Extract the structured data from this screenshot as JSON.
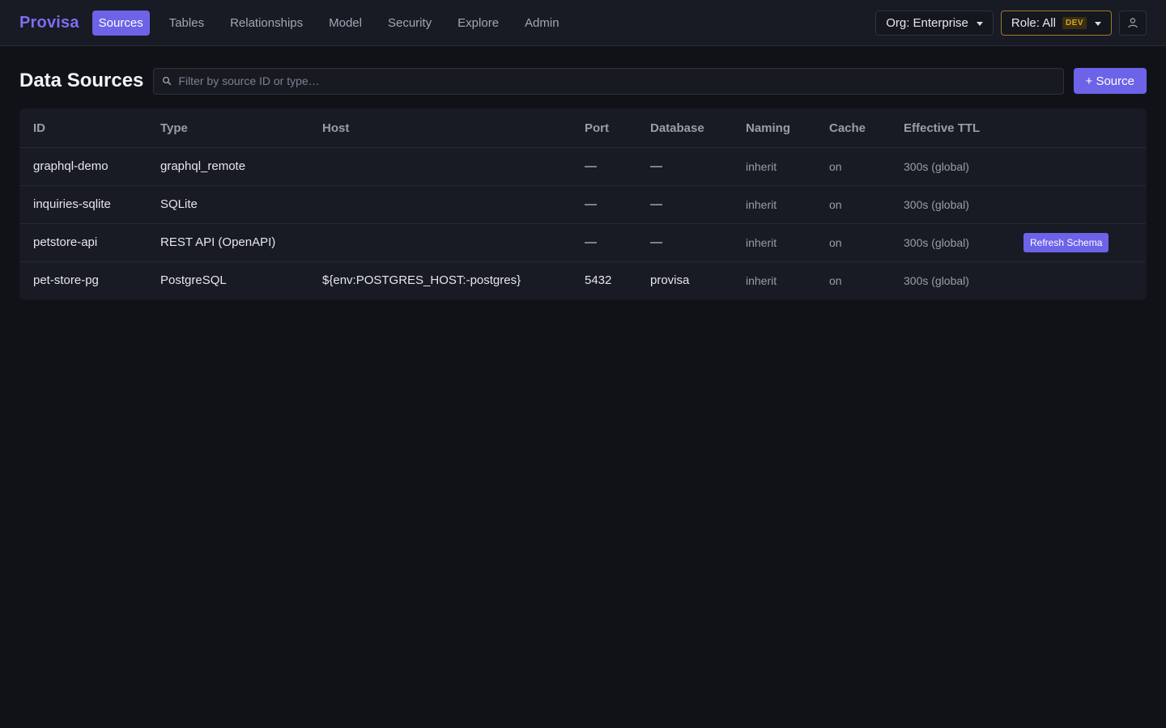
{
  "app": {
    "brand": "Provisa"
  },
  "nav": {
    "items": [
      {
        "label": "Sources",
        "active": true
      },
      {
        "label": "Tables"
      },
      {
        "label": "Relationships"
      },
      {
        "label": "Model"
      },
      {
        "label": "Security"
      },
      {
        "label": "Explore"
      },
      {
        "label": "Admin"
      }
    ]
  },
  "topbar": {
    "org_label": "Org: Enterprise",
    "role_label": "Role: All",
    "role_badge": "DEV",
    "icons": {
      "user": "user-icon",
      "caret": "chevron-down-icon"
    }
  },
  "page": {
    "title": "Data Sources",
    "search_placeholder": "Filter by source ID or type…",
    "add_label": "+ Source"
  },
  "table": {
    "columns": [
      "ID",
      "Type",
      "Host",
      "Port",
      "Database",
      "Naming",
      "Cache",
      "Effective TTL",
      ""
    ],
    "rows": [
      {
        "id": "graphql-demo",
        "type": "graphql_remote",
        "host": "",
        "port": "—",
        "database": "—",
        "naming": "inherit",
        "cache": "on",
        "ttl": "300s (global)",
        "action": ""
      },
      {
        "id": "inquiries-sqlite",
        "type": "SQLite",
        "host": "",
        "port": "—",
        "database": "—",
        "naming": "inherit",
        "cache": "on",
        "ttl": "300s (global)",
        "action": ""
      },
      {
        "id": "petstore-api",
        "type": "REST API (OpenAPI)",
        "host": "",
        "port": "—",
        "database": "—",
        "naming": "inherit",
        "cache": "on",
        "ttl": "300s (global)",
        "action": "Refresh Schema"
      },
      {
        "id": "pet-store-pg",
        "type": "PostgreSQL",
        "host": "${env:POSTGRES_HOST:-postgres}",
        "port": "5432",
        "database": "provisa",
        "naming": "inherit",
        "cache": "on",
        "ttl": "300s (global)",
        "action": ""
      }
    ]
  },
  "colors": {
    "accent": "#6c63e8",
    "brand": "#7b6ff0",
    "role_border": "#9a7a28",
    "badge": "#d9a520"
  }
}
